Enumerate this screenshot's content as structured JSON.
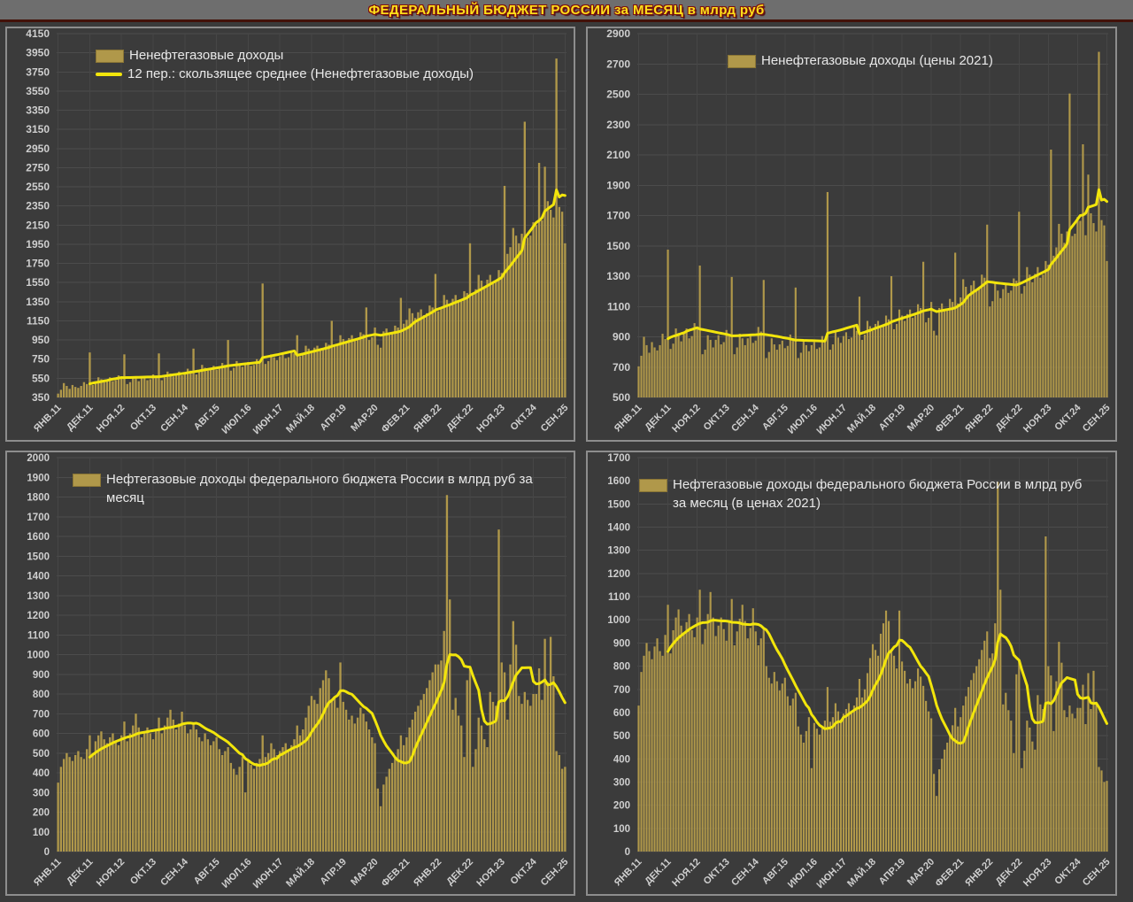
{
  "page": {
    "title": "ФЕДЕРАЛЬНЫЙ БЮДЖЕТ РОССИИ за МЕСЯЦ в млрд руб"
  },
  "colors": {
    "background": "#3b3b3b",
    "title_text": "#ffe11a",
    "title_shadow": "#7a1010",
    "title_underline": "#431109",
    "panel_border": "#8d8d8d",
    "bar_fill": "#b0984a",
    "ma_line": "#f2e50b",
    "grid_h": "#4c4c4c",
    "grid_v": "#464646",
    "axis_text": "#cfcfcf"
  },
  "x_axis": {
    "months_per_tick": 11,
    "tick_labels": [
      "ЯНВ.11",
      "ДЕК.11",
      "НОЯ.12",
      "ОКТ.13",
      "СЕН.14",
      "АВГ.15",
      "ИЮЛ.16",
      "ИЮН.17",
      "МАЙ.18",
      "АПР.19",
      "МАР.20",
      "ФЕВ.21",
      "ЯНВ.22",
      "ДЕК.22",
      "НОЯ.23",
      "ОКТ.24",
      "СЕН.25"
    ]
  },
  "chart_data": [
    {
      "id": "nonoilgas-nominal",
      "type": "bar",
      "legend": [
        {
          "label": "Ненефтегазовые доходы",
          "swatch": "bar"
        },
        {
          "label": "12 пер.: скользящее среднее (Ненефтегазовые доходы)",
          "swatch": "line"
        }
      ],
      "ylim": [
        350,
        4150
      ],
      "ystep": 200,
      "moving_average_periods": 12,
      "values": [
        390,
        430,
        500,
        470,
        440,
        480,
        460,
        450,
        470,
        510,
        490,
        820,
        480,
        500,
        560,
        540,
        510,
        540,
        560,
        520,
        530,
        580,
        560,
        800,
        490,
        510,
        570,
        550,
        520,
        550,
        570,
        530,
        540,
        590,
        570,
        810,
        530,
        560,
        620,
        600,
        570,
        600,
        620,
        580,
        590,
        650,
        630,
        860,
        590,
        620,
        690,
        660,
        630,
        660,
        680,
        640,
        650,
        710,
        690,
        950,
        630,
        660,
        730,
        700,
        670,
        700,
        720,
        680,
        690,
        750,
        730,
        1540,
        700,
        730,
        800,
        770,
        740,
        780,
        800,
        760,
        770,
        830,
        810,
        1000,
        780,
        810,
        890,
        860,
        830,
        870,
        890,
        850,
        860,
        920,
        900,
        1150,
        880,
        910,
        1000,
        960,
        930,
        970,
        1000,
        950,
        960,
        1030,
        1010,
        1290,
        950,
        980,
        1080,
        900,
        870,
        1040,
        1070,
        1020,
        1030,
        1100,
        1080,
        1390,
        1120,
        1160,
        1280,
        1230,
        1180,
        1240,
        1270,
        1210,
        1230,
        1310,
        1290,
        1640,
        1250,
        1290,
        1420,
        1370,
        1310,
        1380,
        1420,
        1350,
        1370,
        1460,
        1440,
        1960,
        1420,
        1480,
        1630,
        1570,
        1510,
        1580,
        1630,
        1550,
        1570,
        1680,
        1650,
        2560,
        1850,
        1920,
        2120,
        2040,
        1960,
        2060,
        3230,
        2020,
        2040,
        2180,
        2150,
        2800,
        2200,
        2760,
        2400,
        2310,
        2230,
        3890,
        2340,
        2290,
        1960
      ]
    },
    {
      "id": "nonoilgas-real2021",
      "type": "bar",
      "legend": [
        {
          "label": "Ненефтегазовые доходы (цены 2021)",
          "swatch": "bar"
        }
      ],
      "ylim": [
        500,
        2900
      ],
      "ystep": 200,
      "moving_average_periods": 12,
      "values": [
        705,
        775,
        900,
        845,
        795,
        865,
        830,
        810,
        845,
        920,
        885,
        1475,
        820,
        855,
        955,
        925,
        870,
        925,
        955,
        890,
        905,
        990,
        955,
        1370,
        785,
        815,
        910,
        880,
        830,
        880,
        910,
        850,
        865,
        945,
        910,
        1295,
        785,
        830,
        920,
        890,
        845,
        890,
        920,
        860,
        875,
        965,
        935,
        1275,
        760,
        800,
        890,
        850,
        815,
        850,
        875,
        825,
        840,
        915,
        890,
        1225,
        760,
        795,
        880,
        845,
        805,
        845,
        865,
        820,
        830,
        905,
        880,
        1855,
        815,
        850,
        930,
        895,
        860,
        905,
        930,
        885,
        895,
        965,
        940,
        1165,
        880,
        915,
        1005,
        970,
        940,
        985,
        1005,
        960,
        970,
        1040,
        1015,
        1300,
        950,
        985,
        1080,
        1040,
        1005,
        1050,
        1080,
        1025,
        1040,
        1115,
        1090,
        1395,
        995,
        1025,
        1130,
        940,
        910,
        1090,
        1120,
        1070,
        1080,
        1150,
        1130,
        1455,
        1120,
        1160,
        1280,
        1230,
        1180,
        1240,
        1270,
        1210,
        1230,
        1310,
        1290,
        1640,
        1100,
        1135,
        1250,
        1205,
        1155,
        1215,
        1250,
        1190,
        1205,
        1285,
        1270,
        1725,
        1185,
        1235,
        1360,
        1310,
        1260,
        1315,
        1360,
        1290,
        1310,
        1400,
        1375,
        2135,
        1435,
        1490,
        1645,
        1580,
        1520,
        1595,
        2505,
        1565,
        1580,
        1690,
        1665,
        2170,
        1570,
        1970,
        1715,
        1650,
        1595,
        2780,
        1670,
        1635,
        1400
      ]
    },
    {
      "id": "oilgas-nominal",
      "type": "bar",
      "legend": [
        {
          "label": "Нефтегазовые доходы федерального бюджета России в млрд руб за месяц",
          "swatch": "bar"
        }
      ],
      "ylim": [
        0,
        2000
      ],
      "ystep": 100,
      "moving_average_periods": 12,
      "values": [
        350,
        430,
        470,
        500,
        480,
        460,
        490,
        510,
        480,
        470,
        520,
        590,
        500,
        560,
        590,
        610,
        570,
        550,
        580,
        600,
        560,
        540,
        590,
        660,
        560,
        600,
        640,
        700,
        630,
        580,
        610,
        630,
        600,
        570,
        620,
        680,
        600,
        640,
        680,
        720,
        670,
        620,
        650,
        710,
        640,
        600,
        620,
        650,
        620,
        580,
        560,
        600,
        570,
        540,
        560,
        580,
        520,
        490,
        510,
        530,
        450,
        420,
        390,
        430,
        480,
        300,
        460,
        440,
        420,
        450,
        470,
        590,
        480,
        500,
        550,
        520,
        490,
        510,
        530,
        550,
        520,
        540,
        570,
        640,
        590,
        620,
        680,
        740,
        790,
        770,
        750,
        830,
        870,
        920,
        880,
        770,
        780,
        730,
        960,
        760,
        720,
        670,
        690,
        650,
        680,
        730,
        700,
        660,
        620,
        580,
        550,
        320,
        230,
        340,
        380,
        420,
        450,
        480,
        520,
        590,
        540,
        580,
        630,
        670,
        710,
        740,
        770,
        800,
        830,
        870,
        910,
        950,
        950,
        970,
        1120,
        1810,
        1280,
        720,
        780,
        690,
        640,
        480,
        870,
        930,
        430,
        520,
        680,
        640,
        570,
        530,
        810,
        760,
        740,
        1635,
        960,
        910,
        670,
        950,
        1170,
        1050,
        790,
        750,
        810,
        770,
        740,
        800,
        800,
        930,
        770,
        1080,
        860,
        1090,
        890,
        510,
        490,
        420,
        430
      ]
    },
    {
      "id": "oilgas-real2021",
      "type": "bar",
      "legend": [
        {
          "label": "Нефтегазовые доходы федерального бюджета России в млрд руб за месяц (в ценах 2021)",
          "swatch": "bar"
        }
      ],
      "ylim": [
        0,
        1700
      ],
      "ystep": 100,
      "moving_average_periods": 12,
      "values": [
        630,
        775,
        845,
        900,
        865,
        830,
        885,
        920,
        865,
        845,
        935,
        1065,
        855,
        955,
        1010,
        1045,
        975,
        940,
        990,
        1025,
        955,
        925,
        1010,
        1130,
        895,
        960,
        1025,
        1120,
        1010,
        930,
        975,
        1010,
        960,
        910,
        990,
        1090,
        890,
        950,
        1005,
        1065,
        995,
        920,
        965,
        1050,
        950,
        890,
        920,
        965,
        800,
        750,
        725,
        775,
        735,
        695,
        725,
        750,
        670,
        630,
        660,
        685,
        540,
        505,
        470,
        520,
        580,
        360,
        555,
        530,
        505,
        540,
        565,
        710,
        560,
        580,
        640,
        605,
        570,
        595,
        615,
        640,
        605,
        630,
        665,
        745,
        665,
        700,
        770,
        835,
        895,
        870,
        845,
        940,
        985,
        1040,
        995,
        870,
        845,
        790,
        1040,
        820,
        780,
        725,
        745,
        705,
        735,
        790,
        755,
        715,
        650,
        605,
        575,
        335,
        240,
        355,
        400,
        440,
        470,
        505,
        545,
        620,
        540,
        580,
        630,
        670,
        710,
        740,
        770,
        800,
        830,
        870,
        910,
        950,
        835,
        855,
        985,
        1595,
        1130,
        635,
        685,
        610,
        565,
        425,
        765,
        820,
        360,
        435,
        565,
        535,
        475,
        440,
        675,
        635,
        615,
        1360,
        800,
        760,
        520,
        735,
        905,
        815,
        610,
        580,
        630,
        595,
        575,
        620,
        620,
        720,
        550,
        770,
        615,
        780,
        635,
        365,
        350,
        300,
        305
      ]
    }
  ]
}
